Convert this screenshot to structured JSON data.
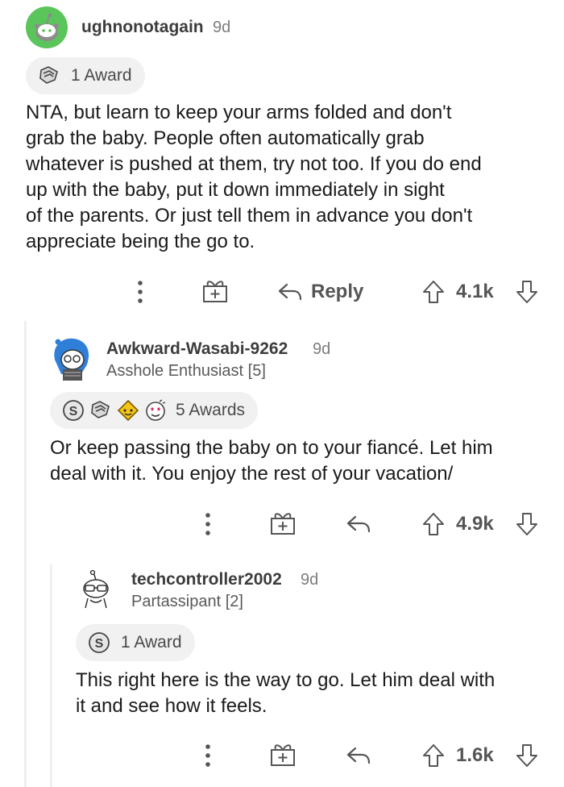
{
  "comments": [
    {
      "username": "ughnonotagain",
      "age": "9d",
      "flair": "",
      "award_label": "1 Award",
      "award_icons": [
        "handshake-award-icon"
      ],
      "body_lines": [
        "NTA, but learn to keep your arms folded and don't",
        "grab the baby. People often automatically grab",
        "whatever is pushed at them, try not too. If you do end",
        "up with the baby, put it down immediately in sight",
        "of the parents. Or just tell them in advance you don't",
        "appreciate being the go to."
      ],
      "reply_label": "Reply",
      "score": "4.1k"
    },
    {
      "username": "Awkward-Wasabi-9262",
      "age": "9d",
      "flair": "Asshole Enthusiast [5]",
      "award_label": "5 Awards",
      "award_icons": [
        "silver-award-icon",
        "handshake-award-icon",
        "wholesome-award-icon",
        "heart-eyes-award-icon"
      ],
      "body_lines": [
        "Or keep passing the baby on to your fiancé. Let him",
        "deal with it. You enjoy the rest of your vacation/"
      ],
      "score": "4.9k"
    },
    {
      "username": "techcontroller2002",
      "age": "9d",
      "flair": "Partassipant [2]",
      "award_label": "1 Award",
      "award_icons": [
        "silver-award-icon"
      ],
      "body_lines": [
        "This right here is the way to go. Let him deal with",
        "it and see how it feels."
      ],
      "score": "1.6k"
    }
  ],
  "colors": {
    "avatar_green": "#5ac55a",
    "avatar_blue": "#2f7fd9",
    "award_pill_bg": "#f1f1f1",
    "thread_line": "#edeff1",
    "icon_gray": "#555555"
  }
}
